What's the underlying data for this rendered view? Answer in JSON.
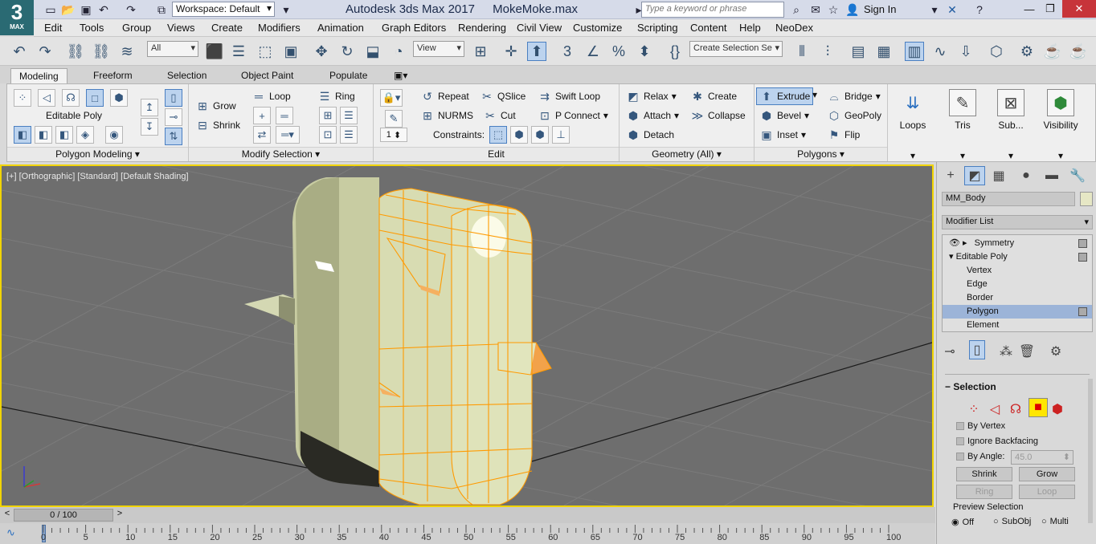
{
  "title_bar": {
    "logo_number": "3",
    "logo_text": "MAX",
    "workspace": "Workspace: Default",
    "app_title": "Autodesk 3ds Max 2017",
    "file_name": "MokeMoke.max",
    "search_placeholder": "Type a keyword or phrase",
    "sign_in": "Sign In"
  },
  "menu": [
    "Edit",
    "Tools",
    "Group",
    "Views",
    "Create",
    "Modifiers",
    "Animation",
    "Graph Editors",
    "Rendering",
    "Civil View",
    "Customize",
    "Scripting",
    "Content",
    "Help",
    "NeoDex"
  ],
  "toolbar": {
    "selection_filter": "All",
    "ref_coord": "View",
    "selection_set": "Create Selection Se"
  },
  "ribbon": {
    "tabs": [
      "Modeling",
      "Freeform",
      "Selection",
      "Object Paint",
      "Populate"
    ],
    "polygon_modeling": {
      "label": "Editable Poly",
      "footer": "Polygon Modeling"
    },
    "modify_selection": {
      "grow": "Grow",
      "shrink": "Shrink",
      "loop": "Loop",
      "ring": "Ring",
      "footer": "Modify Selection"
    },
    "edit": {
      "repeat": "Repeat",
      "qslice": "QSlice",
      "swift_loop": "Swift Loop",
      "nurms": "NURMS",
      "cut": "Cut",
      "p_connect": "P Connect",
      "constraints": "Constraints:",
      "spinner_value": "1",
      "footer": "Edit"
    },
    "geometry": {
      "relax": "Relax",
      "create": "Create",
      "attach": "Attach",
      "collapse": "Collapse",
      "detach": "Detach",
      "footer": "Geometry (All)"
    },
    "polygons": {
      "extrude": "Extrude",
      "bridge": "Bridge",
      "bevel": "Bevel",
      "geopoly": "GeoPoly",
      "inset": "Inset",
      "flip": "Flip",
      "footer": "Polygons"
    },
    "big_buttons": [
      "Loops",
      "Tris",
      "Sub...",
      "Visibility"
    ]
  },
  "viewport": {
    "label": "[+] [Orthographic] [Standard] [Default Shading]"
  },
  "command_panel": {
    "object_name": "MM_Body",
    "modifier_list": "Modifier List",
    "stack": [
      "Symmetry",
      "Editable Poly",
      "Vertex",
      "Edge",
      "Border",
      "Polygon",
      "Element"
    ],
    "selection_title": "Selection",
    "by_vertex": "By Vertex",
    "ignore_backfacing": "Ignore Backfacing",
    "by_angle": "By Angle:",
    "angle_value": "45.0",
    "shrink": "Shrink",
    "grow": "Grow",
    "ring": "Ring",
    "loop": "Loop",
    "preview_selection": "Preview Selection",
    "preview_options": [
      "Off",
      "SubObj",
      "Multi"
    ]
  },
  "timeline": {
    "frame": "0 / 100",
    "ticks": [
      "0",
      "5",
      "10",
      "15",
      "20",
      "25",
      "30",
      "35",
      "40",
      "45",
      "50",
      "55",
      "60",
      "65",
      "70",
      "75",
      "80",
      "85",
      "90",
      "95",
      "100"
    ]
  },
  "colors": {
    "viewport_border": "#f1d400",
    "selection_wire": "#ff9a00",
    "model_fill": "#d8dcb2",
    "close_button": "#c7343a"
  }
}
